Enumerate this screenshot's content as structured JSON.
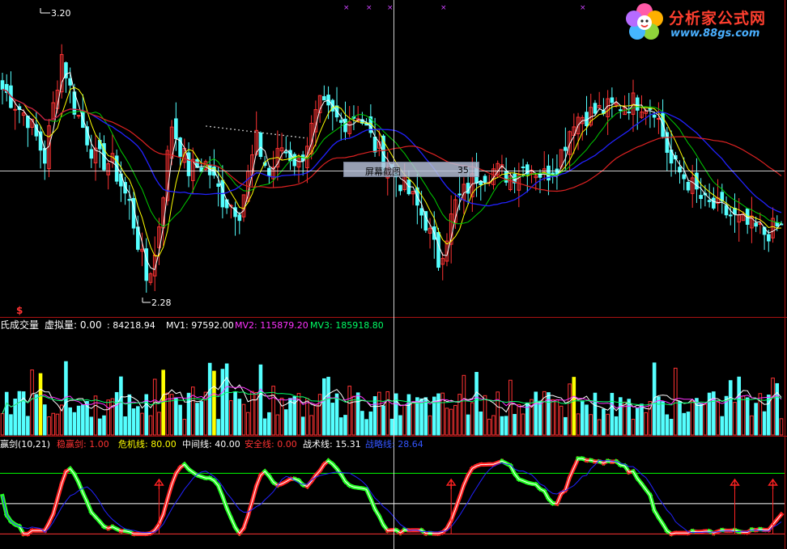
{
  "price_panel": {
    "high_label": "3.20",
    "low_label": "2.28",
    "ylim": [
      2.2,
      3.25
    ],
    "tooltip": {
      "label": "屏幕截图",
      "value": "35"
    }
  },
  "volume_panel": {
    "marker": "$",
    "title": "氏成交量",
    "legend": [
      {
        "key": "vir",
        "text": "虚拟量: 0.00",
        "color": "#ffffff"
      },
      {
        "key": "vol",
        "text": ": 84218.94",
        "color": "#ffffff"
      },
      {
        "key": "mv1",
        "text": "MV1: 97592.00",
        "color": "#ffffff"
      },
      {
        "key": "mv2",
        "text": "MV2: 115879.20",
        "color": "#ff33ff"
      },
      {
        "key": "mv3",
        "text": "MV3: 185918.80",
        "color": "#00ff66"
      }
    ]
  },
  "indicator_panel": {
    "legend": [
      {
        "key": "name",
        "text": "赢剑(10,21)",
        "color": "#ffffff"
      },
      {
        "key": "wen",
        "text": "稳赢剑: 1.00",
        "color": "#ff3333"
      },
      {
        "key": "wei",
        "text": "危机线: 80.00",
        "color": "#ffff00"
      },
      {
        "key": "zhong",
        "text": "中间线: 40.00",
        "color": "#ffffff"
      },
      {
        "key": "an",
        "text": "安全线: 0.00",
        "color": "#ff3333"
      },
      {
        "key": "zhan",
        "text": "战术线: 15.31",
        "color": "#ffffff"
      },
      {
        "key": "lue",
        "text": "战略线: 28.64",
        "color": "#3355ff"
      }
    ],
    "levels": [
      80,
      40,
      0
    ]
  },
  "brand": {
    "title": "分析家公式网",
    "url": "www.88gs.com"
  },
  "colors": {
    "up": "#ff3333",
    "down": "#55ffff",
    "volume_highlight": "#ffff00",
    "ma_white": "#ffffff",
    "ma_yellow": "#ffff00",
    "ma_green": "#00cc00",
    "ma_blue": "#2222ff",
    "ma_red": "#dd2222",
    "kdj_fast": "#ffffff",
    "kdj_slow": "#2222ff",
    "trend_up": "#ff2222",
    "trend_down": "#22ff22"
  },
  "chart_data": {
    "type": "candlestick",
    "price_keypoints": [
      [
        0,
        2.98
      ],
      [
        6,
        2.88
      ],
      [
        10,
        2.74
      ],
      [
        14,
        3.1
      ],
      [
        17,
        2.92
      ],
      [
        22,
        2.74
      ],
      [
        26,
        2.72
      ],
      [
        30,
        2.58
      ],
      [
        34,
        2.32
      ],
      [
        36,
        2.4
      ],
      [
        40,
        2.86
      ],
      [
        44,
        2.7
      ],
      [
        48,
        2.72
      ],
      [
        52,
        2.6
      ],
      [
        56,
        2.56
      ],
      [
        60,
        2.8
      ],
      [
        63,
        2.68
      ],
      [
        66,
        2.78
      ],
      [
        70,
        2.72
      ],
      [
        75,
        2.92
      ],
      [
        80,
        2.86
      ],
      [
        84,
        2.9
      ],
      [
        88,
        2.78
      ],
      [
        92,
        2.7
      ],
      [
        96,
        2.62
      ],
      [
        100,
        2.52
      ],
      [
        103,
        2.38
      ],
      [
        107,
        2.58
      ],
      [
        112,
        2.68
      ],
      [
        116,
        2.7
      ],
      [
        120,
        2.68
      ],
      [
        124,
        2.72
      ],
      [
        128,
        2.68
      ],
      [
        131,
        2.72
      ],
      [
        135,
        2.88
      ],
      [
        140,
        2.9
      ],
      [
        145,
        2.92
      ],
      [
        150,
        2.94
      ],
      [
        154,
        2.92
      ],
      [
        158,
        2.72
      ],
      [
        162,
        2.66
      ],
      [
        166,
        2.58
      ],
      [
        170,
        2.56
      ],
      [
        174,
        2.52
      ],
      [
        177,
        2.5
      ],
      [
        180,
        2.48
      ],
      [
        183,
        2.5
      ]
    ],
    "volume_highlights": [
      9,
      38,
      50,
      135
    ],
    "signal_days": [
      37,
      106,
      173,
      182
    ]
  }
}
